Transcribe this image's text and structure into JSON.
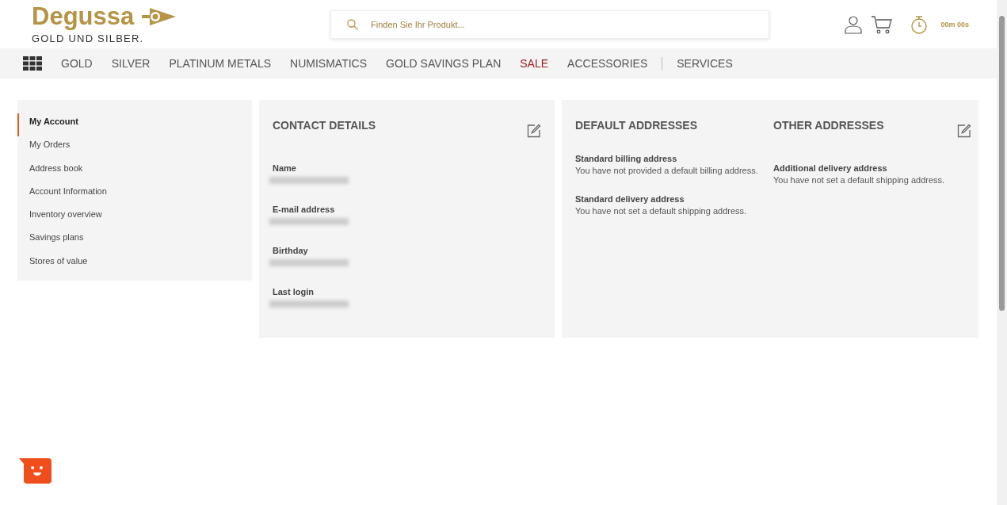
{
  "header": {
    "brand": "Degussa",
    "tagline": "GOLD UND SILBER.",
    "search": {
      "placeholder": "Finden Sie Ihr Produkt..."
    },
    "timer": "00m 00s"
  },
  "nav": [
    {
      "label": "GOLD",
      "highlight": false,
      "divider_before": false
    },
    {
      "label": "SILVER",
      "highlight": false,
      "divider_before": false
    },
    {
      "label": "PLATINUM METALS",
      "highlight": false,
      "divider_before": false
    },
    {
      "label": "NUMISMATICS",
      "highlight": false,
      "divider_before": false
    },
    {
      "label": "GOLD SAVINGS PLAN",
      "highlight": false,
      "divider_before": false
    },
    {
      "label": "SALE",
      "highlight": true,
      "divider_before": false
    },
    {
      "label": "ACCESSORIES",
      "highlight": false,
      "divider_before": false
    },
    {
      "label": "SERVICES",
      "highlight": false,
      "divider_before": true
    }
  ],
  "sidebar": {
    "items": [
      {
        "label": "My Account",
        "selected": true
      },
      {
        "label": "My Orders",
        "selected": false
      },
      {
        "label": "Address book",
        "selected": false
      },
      {
        "label": "Account Information",
        "selected": false
      },
      {
        "label": "Inventory overview",
        "selected": false
      },
      {
        "label": "Savings plans",
        "selected": false
      },
      {
        "label": "Stores of value",
        "selected": false
      }
    ]
  },
  "contact": {
    "title": "CONTACT DETAILS",
    "fields": [
      {
        "label": "Name",
        "redacted": true
      },
      {
        "label": "E-mail address",
        "redacted": true
      },
      {
        "label": "Birthday",
        "redacted": true
      },
      {
        "label": "Last login",
        "redacted": true
      }
    ]
  },
  "addresses": [
    {
      "title": "DEFAULT ADDRESSES",
      "editable": false,
      "entries": [
        {
          "label": "Standard billing address",
          "text": "You have not provided a default billing address."
        },
        {
          "label": "Standard delivery address",
          "text": "You have not set a default shipping address."
        }
      ]
    },
    {
      "title": "OTHER ADDRESSES",
      "editable": true,
      "entries": [
        {
          "label": "Additional delivery address",
          "text": "You have not set a default shipping address."
        }
      ]
    }
  ]
}
